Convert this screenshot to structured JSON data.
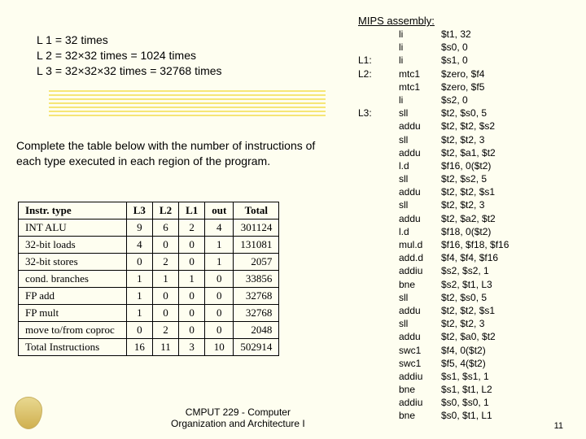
{
  "loops": {
    "l1": "L 1 = 32 times",
    "l2": "L 2 = 32×32 times = 1024 times",
    "l3": "L 3 = 32×32×32 times = 32768 times"
  },
  "prompt": "Complete the table below with the number of instructions of each type executed in each region of the program.",
  "table": {
    "headers": [
      "Instr. type",
      "L3",
      "L2",
      "L1",
      "out",
      "Total"
    ],
    "rows": [
      [
        "INT ALU",
        "9",
        "6",
        "2",
        "4",
        "301124"
      ],
      [
        "32-bit loads",
        "4",
        "0",
        "0",
        "1",
        "131081"
      ],
      [
        "32-bit stores",
        "0",
        "2",
        "0",
        "1",
        "2057"
      ],
      [
        "cond. branches",
        "1",
        "1",
        "1",
        "0",
        "33856"
      ],
      [
        "FP add",
        "1",
        "0",
        "0",
        "0",
        "32768"
      ],
      [
        "FP mult",
        "1",
        "0",
        "0",
        "0",
        "32768"
      ],
      [
        "move to/from coproc",
        "0",
        "2",
        "0",
        "0",
        "2048"
      ],
      [
        "Total Instructions",
        "16",
        "11",
        "3",
        "10",
        "502914"
      ]
    ]
  },
  "assembly": {
    "title": "MIPS assembly:",
    "lines": [
      {
        "label": "",
        "op": "li",
        "args": "$t1, 32"
      },
      {
        "label": "",
        "op": "li",
        "args": "$s0, 0"
      },
      {
        "label": "L1:",
        "op": "li",
        "args": "$s1, 0"
      },
      {
        "label": "L2:",
        "op": "mtc1",
        "args": "$zero, $f4"
      },
      {
        "label": "",
        "op": "mtc1",
        "args": "$zero, $f5"
      },
      {
        "label": "",
        "op": "li",
        "args": "$s2, 0"
      },
      {
        "label": "L3:",
        "op": "sll",
        "args": "$t2, $s0, 5"
      },
      {
        "label": "",
        "op": "addu",
        "args": "$t2, $t2, $s2"
      },
      {
        "label": "",
        "op": "sll",
        "args": "$t2, $t2, 3"
      },
      {
        "label": "",
        "op": "addu",
        "args": "$t2, $a1, $t2"
      },
      {
        "label": "",
        "op": "l.d",
        "args": "$f16, 0($t2)"
      },
      {
        "label": "",
        "op": "sll",
        "args": "$t2, $s2, 5"
      },
      {
        "label": "",
        "op": "addu",
        "args": "$t2, $t2, $s1"
      },
      {
        "label": "",
        "op": "sll",
        "args": "$t2, $t2, 3"
      },
      {
        "label": "",
        "op": "addu",
        "args": "$t2, $a2, $t2"
      },
      {
        "label": "",
        "op": "l.d",
        "args": "$f18, 0($t2)"
      },
      {
        "label": "",
        "op": "mul.d",
        "args": "$f16, $f18, $f16"
      },
      {
        "label": "",
        "op": "add.d",
        "args": "$f4, $f4, $f16"
      },
      {
        "label": "",
        "op": "addiu",
        "args": "$s2, $s2, 1"
      },
      {
        "label": "",
        "op": "bne",
        "args": "$s2, $t1, L3"
      },
      {
        "label": "",
        "op": "sll",
        "args": "$t2, $s0, 5"
      },
      {
        "label": "",
        "op": "addu",
        "args": "$t2, $t2, $s1"
      },
      {
        "label": "",
        "op": "sll",
        "args": "$t2, $t2, 3"
      },
      {
        "label": "",
        "op": "addu",
        "args": "$t2, $a0, $t2"
      },
      {
        "label": "",
        "op": "swc1",
        "args": "$f4, 0($t2)"
      },
      {
        "label": "",
        "op": "swc1",
        "args": "$f5, 4($t2)"
      },
      {
        "label": "",
        "op": "addiu",
        "args": "$s1, $s1, 1"
      },
      {
        "label": "",
        "op": "bne",
        "args": "$s1, $t1, L2"
      },
      {
        "label": "",
        "op": "addiu",
        "args": "$s0, $s0, 1"
      },
      {
        "label": "",
        "op": "bne",
        "args": "$s0, $t1, L1"
      }
    ]
  },
  "footer": {
    "line1": "CMPUT 229 - Computer",
    "line2": "Organization and Architecture I"
  },
  "pagenum": "11"
}
